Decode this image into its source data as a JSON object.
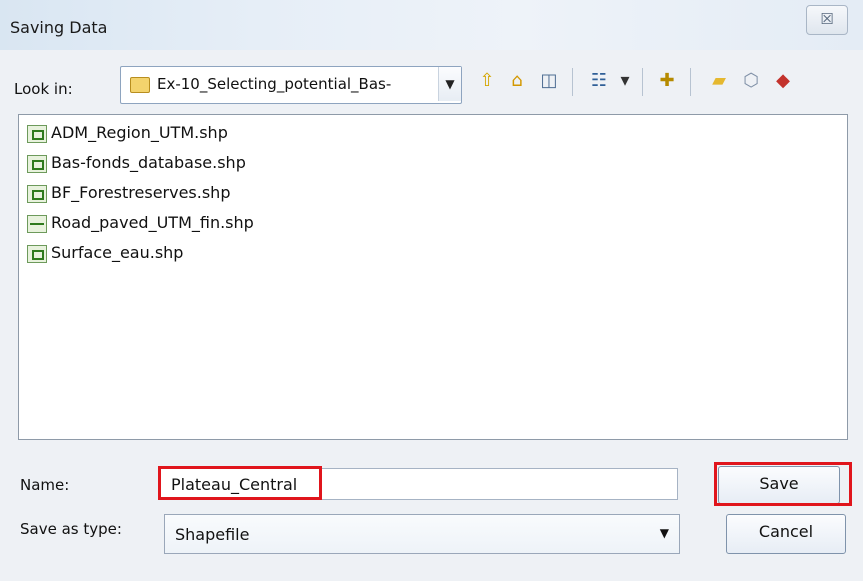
{
  "window": {
    "title": "Saving Data",
    "close_glyph": "☒"
  },
  "lookin": {
    "label": "Look in:",
    "value": "Ex-10_Selecting_potential_Bas-",
    "folder_icon": "folder-icon",
    "dropdown_glyph": "▼"
  },
  "toolbar": [
    {
      "name": "up-folder-icon",
      "glyph": "⇧",
      "color": "#d4a600"
    },
    {
      "name": "home-icon",
      "glyph": "⌂",
      "color": "#d39800"
    },
    {
      "name": "catalog-icon",
      "glyph": "◫",
      "color": "#4f6e93"
    },
    {
      "name": "details-view-icon",
      "glyph": "☷",
      "color": "#2f5f97"
    },
    {
      "name": "view-dropdown-icon",
      "glyph": "▾",
      "color": "#333333"
    },
    {
      "name": "new-feature-icon",
      "glyph": "✚",
      "color": "#b58a00"
    },
    {
      "name": "new-folder-icon",
      "glyph": "▰",
      "color": "#e5b82f"
    },
    {
      "name": "database-icon",
      "glyph": "⬡",
      "color": "#7e8fa6"
    },
    {
      "name": "toolbox-icon",
      "glyph": "◆",
      "color": "#c3322c"
    }
  ],
  "files": [
    {
      "name": "ADM_Region_UTM.shp",
      "icon": "polygon-shapefile-icon"
    },
    {
      "name": "Bas-fonds_database.shp",
      "icon": "polygon-shapefile-icon"
    },
    {
      "name": "BF_Forestreserves.shp",
      "icon": "polygon-shapefile-icon"
    },
    {
      "name": "Road_paved_UTM_fin.shp",
      "icon": "line-shapefile-icon"
    },
    {
      "name": "Surface_eau.shp",
      "icon": "polygon-shapefile-icon"
    }
  ],
  "name_field": {
    "label": "Name:",
    "value": "Plateau_Central"
  },
  "type_field": {
    "label": "Save as type:",
    "value": "Shapefile",
    "dropdown_glyph": "▼"
  },
  "buttons": {
    "save": "Save",
    "cancel": "Cancel"
  },
  "colors": {
    "highlight": "#e0151c"
  }
}
